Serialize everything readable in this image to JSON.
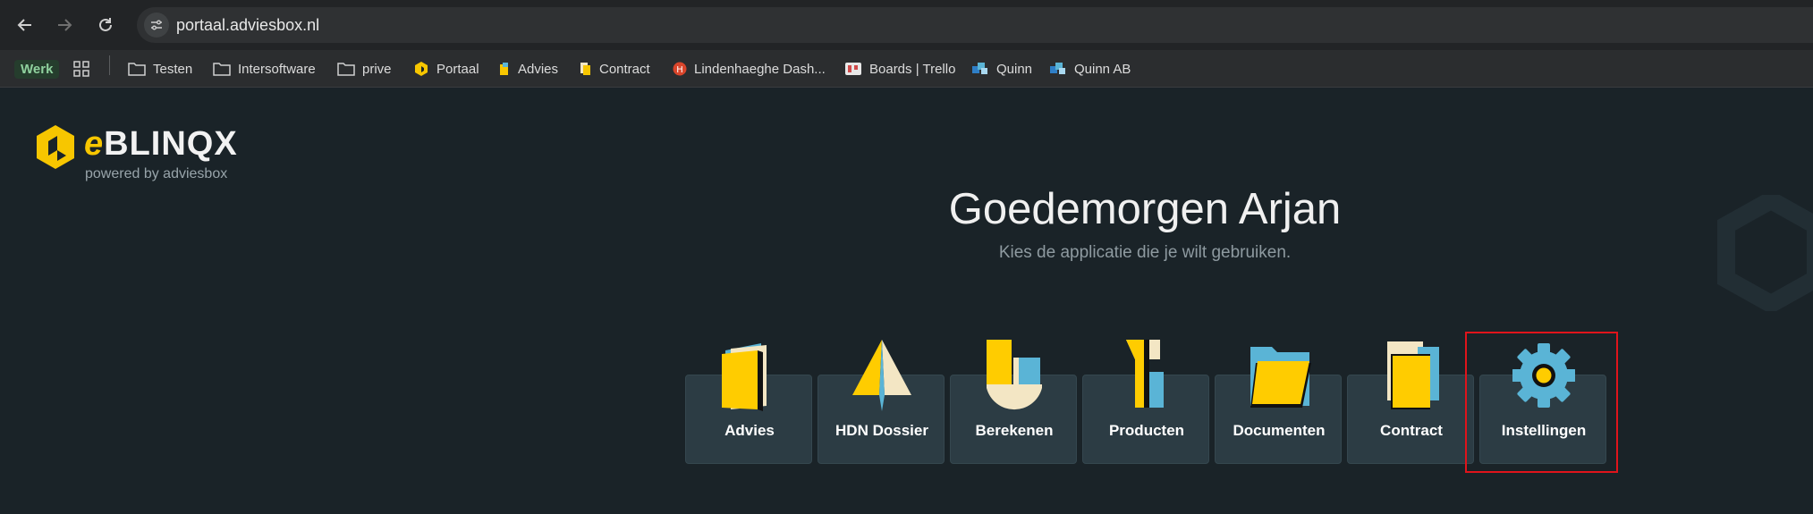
{
  "browser": {
    "url": "portaal.adviesbox.nl",
    "bookmarks": [
      {
        "label": "Werk",
        "icon": "tab-group-badge"
      },
      {
        "label": "",
        "icon": "apps-grid-icon"
      },
      {
        "label": "Testen",
        "icon": "folder-icon"
      },
      {
        "label": "Intersoftware",
        "icon": "folder-icon"
      },
      {
        "label": "prive",
        "icon": "folder-icon"
      },
      {
        "label": "Portaal",
        "icon": "hexagon-favicon"
      },
      {
        "label": "Advies",
        "icon": "advies-favicon"
      },
      {
        "label": "Contract",
        "icon": "contract-favicon"
      },
      {
        "label": "Lindenhaeghe Dash...",
        "icon": "lindenhaeghe-favicon"
      },
      {
        "label": "Boards | Trello",
        "icon": "trello-favicon"
      },
      {
        "label": "Quinn",
        "icon": "quinn-favicon"
      },
      {
        "label": "Quinn AB",
        "icon": "quinn-favicon"
      }
    ]
  },
  "brand": {
    "name_prefix": "e",
    "name_rest": "BLINQX",
    "tagline": "powered by adviesbox",
    "accent": "#f7c600"
  },
  "main": {
    "greeting": "Goedemorgen Arjan",
    "subtitle": "Kies de applicatie die je wilt gebruiken."
  },
  "apps": [
    {
      "label": "Advies",
      "icon": "book-icon"
    },
    {
      "label": "HDN Dossier",
      "icon": "paper-plane-icon"
    },
    {
      "label": "Berekenen",
      "icon": "calculator-shape-icon"
    },
    {
      "label": "Producten",
      "icon": "products-icon"
    },
    {
      "label": "Documenten",
      "icon": "folder-open-icon"
    },
    {
      "label": "Contract",
      "icon": "contract-icon"
    },
    {
      "label": "Instellingen",
      "icon": "gear-icon"
    }
  ],
  "colors": {
    "yellow": "#ffcc00",
    "blue": "#5ab4d6",
    "cream": "#f3e6c4",
    "tile_bg": "#2c3c44",
    "highlight": "#e0141b"
  }
}
